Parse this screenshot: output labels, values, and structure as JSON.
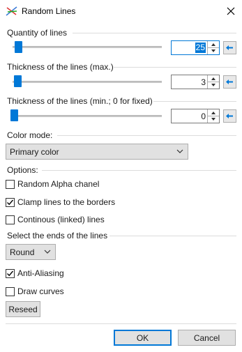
{
  "window": {
    "title": "Random Lines",
    "app_icon": "random-lines-icon",
    "close_icon": "close-icon"
  },
  "quantity": {
    "label": "Quantity of lines",
    "value": "25",
    "slider_level": 0.12
  },
  "thickness_max": {
    "label": "Thickness of the lines (max.)",
    "value": "3",
    "slider_level": 0.03
  },
  "thickness_min": {
    "label": "Thickness of the lines (min.; 0 for fixed)",
    "value": "0",
    "slider_level": 0.0
  },
  "color_mode": {
    "label": "Color mode:",
    "selected": "Primary color"
  },
  "options": {
    "label": "Options:",
    "random_alpha": {
      "label": "Random Alpha chanel",
      "checked": false
    },
    "clamp_lines": {
      "label": "Clamp lines to the borders",
      "checked": true
    },
    "continuous": {
      "label": "Continous (linked) lines",
      "checked": false
    }
  },
  "ends": {
    "label": "Select the ends of the lines",
    "selected": "Round"
  },
  "anti_aliasing": {
    "label": "Anti-Aliasing",
    "checked": true
  },
  "draw_curves": {
    "label": "Draw curves",
    "checked": false
  },
  "buttons": {
    "reseed": "Reseed",
    "ok": "OK",
    "cancel": "Cancel"
  },
  "colors": {
    "accent": "#0078d7",
    "reset_arrow": "#0078d7"
  }
}
